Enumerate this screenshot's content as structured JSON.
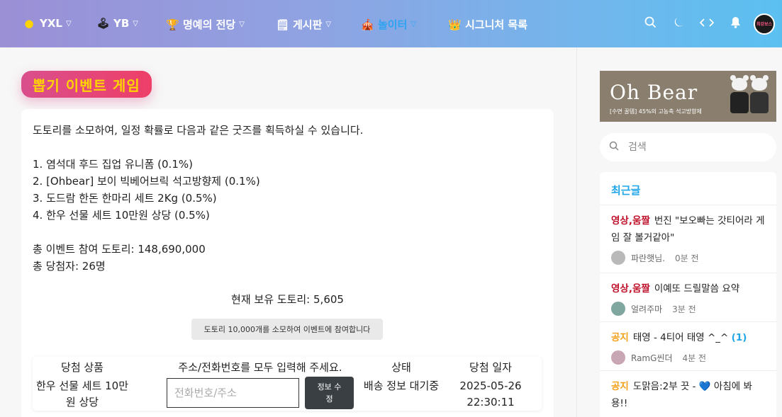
{
  "nav": {
    "items": [
      {
        "icon": "coin-icon",
        "glyph": "😐",
        "label": "YXL",
        "chevron": true,
        "active": false
      },
      {
        "icon": "joystick-icon",
        "glyph": "🕹",
        "label": "YB",
        "chevron": true,
        "active": false
      },
      {
        "icon": "trophy-icon",
        "glyph": "🏆",
        "label": "명예의 전당",
        "chevron": true,
        "active": false
      },
      {
        "icon": "notepad-icon",
        "glyph": "🗒",
        "label": "게시판",
        "chevron": true,
        "active": false
      },
      {
        "icon": "circus-tent-icon",
        "glyph": "🎪",
        "label": "놀이터",
        "chevron": true,
        "active": true
      },
      {
        "icon": "crown-icon",
        "glyph": "👑",
        "label": "시그니처 목록",
        "chevron": false,
        "active": false
      }
    ],
    "right_icons": [
      "search-icon",
      "moon-icon",
      "code-icon",
      "bell-icon"
    ],
    "avatar_text": "최강보스"
  },
  "page": {
    "title": "뽑기 이벤트 게임",
    "description": [
      "도토리를 소모하여, 일정 확률로 다음과 같은 굿즈를 획득하실 수 있습니다.",
      "",
      "1. 염석대 후드 집업 유니폼 (0.1%)",
      "2. [Ohbear] 보이 빅베어브릭 석고방향제 (0.1%)",
      "3. 도드람 한돈 한마리 세트 2Kg (0.5%)",
      "4. 한우 선물 세트 10만원 상당 (0.5%)",
      "",
      "총 이벤트 참여 도토리: 148,690,000",
      "총 당첨자: 26명"
    ],
    "current_acorns": "현재 보유 도토리: 5,605",
    "join_button": "도토리 10,000개를 소모하여 이벤트에 참여합니다"
  },
  "win_table": {
    "headers": {
      "prize": "당첨 상품",
      "address": "주소/전화번호를 모두 입력해 주세요.",
      "status": "상태",
      "date": "당첨 일자"
    },
    "row": {
      "prize": "한우 선물 세트 10만원 상당",
      "address_placeholder": "전화번호/주소",
      "edit_button": "정보 수정",
      "status": "배송 정보 대기중",
      "date": "2025-05-26",
      "time": "22:30:11"
    }
  },
  "sidebar": {
    "ad": {
      "title": "Oh Bear",
      "subtitle": "[수면 꿀템] 45%의 고농축 석고방향제"
    },
    "search_placeholder": "검색",
    "recent_title": "최근글",
    "posts": [
      {
        "category": "영상,움짤",
        "cat_color": "#c0112b",
        "title": "번진 \"보오빠는 갓티어라 게임 잘 볼거같아\"",
        "count": "",
        "author": "파란햇님.",
        "time": "0분 전"
      },
      {
        "category": "영상,움짤",
        "cat_color": "#c0112b",
        "title": "이예또 드릴말씀 요약",
        "count": "",
        "author": "얼려주마",
        "time": "3분 전"
      },
      {
        "category": "공지",
        "cat_color": "#f3a01b",
        "title": "태영 - 4티어 태영 ^_^",
        "count": "(1)",
        "author": "RamG씬더",
        "time": "4분 전"
      },
      {
        "category": "공지",
        "cat_color": "#f3a01b",
        "title": "도맑음:2부 끗 - 💙 아침에 봐용!!",
        "count": "",
        "author": "",
        "time": ""
      }
    ]
  }
}
